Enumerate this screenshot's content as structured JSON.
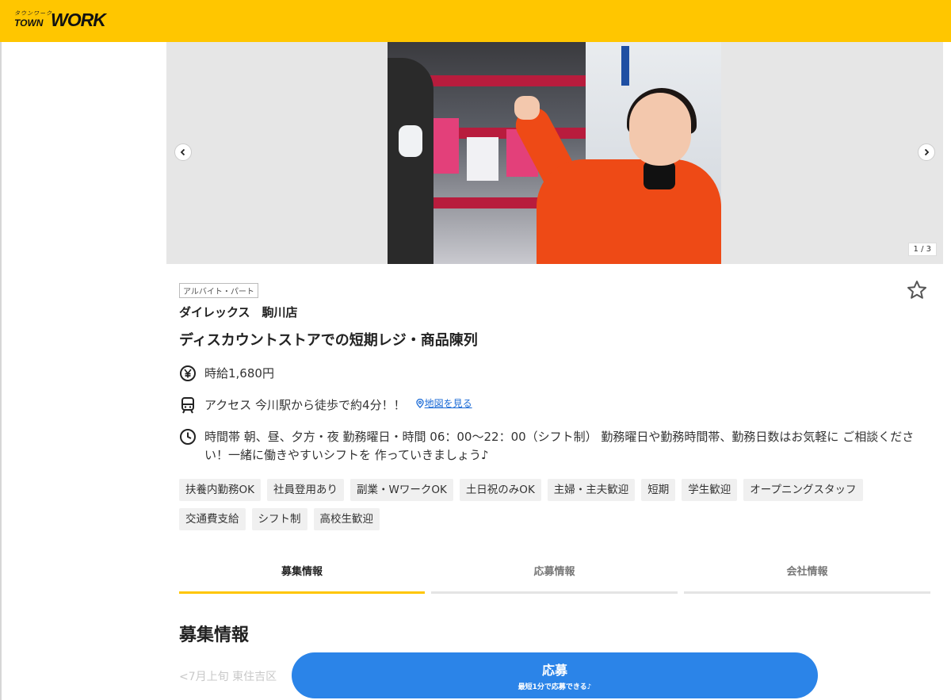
{
  "header": {
    "logo_small": "タウンワーク",
    "logo_town": "TOWN",
    "logo_work": "WORK",
    "brand_color": "#ffc600"
  },
  "carousel": {
    "prev_icon": "chevron-left-icon",
    "next_icon": "chevron-right-icon",
    "counter": "1 / 3"
  },
  "job": {
    "employment_type": "アルバイト・パート",
    "company": "ダイレックス　駒川店",
    "title": "ディスカウントストアでの短期レジ・商品陳列",
    "salary": "時給1,680円",
    "access": "アクセス 今川駅から徒歩で約4分！！",
    "map_link": "地図を見る",
    "hours": "時間帯 朝、昼、夕方・夜 勤務曜日・時間 06：00〜22：00（シフト制） 勤務曜日や勤務時間帯、勤務日数はお気軽に ご相談ください！一緒に働きやすいシフトを 作っていきましょう♪"
  },
  "tags": [
    "扶養内勤務OK",
    "社員登用あり",
    "副業・WワークOK",
    "土日祝のみOK",
    "主婦・主夫歓迎",
    "短期",
    "学生歓迎",
    "オープニングスタッフ",
    "交通費支給",
    "シフト制",
    "高校生歓迎"
  ],
  "tabs": [
    {
      "label": "募集情報",
      "active": true
    },
    {
      "label": "応募情報",
      "active": false
    },
    {
      "label": "会社情報",
      "active": false
    }
  ],
  "section": {
    "heading": "募集情報",
    "faded_text": "<7月上旬 東住吉区"
  },
  "apply": {
    "label": "応募",
    "sub": "最短1分で応募できる♪",
    "color": "#2b84e8"
  }
}
